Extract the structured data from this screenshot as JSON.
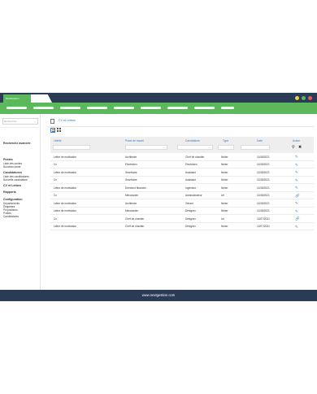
{
  "app": {
    "tab_label": "NextGestion"
  },
  "window_controls": [
    "#e8d34a",
    "#5cb85c",
    "#e05c5c"
  ],
  "sidebar": {
    "search_placeholder": "Rechercher",
    "sections": [
      {
        "label": "Recherche avancée",
        "bold": true
      },
      {
        "label": "Postes",
        "bold": true
      },
      {
        "label": "Liste des postes",
        "bold": false
      },
      {
        "label": "Nouveau poste",
        "bold": false
      },
      {
        "label": "Candidatures",
        "bold": true
      },
      {
        "label": "Liste des candidatures",
        "bold": false
      },
      {
        "label": "Nouvelle candidature",
        "bold": false
      },
      {
        "label": "CV et Lettres",
        "bold": true
      },
      {
        "label": "Rapports",
        "bold": true
      },
      {
        "label": "Configuration",
        "bold": true
      },
      {
        "label": "Départements",
        "bold": false
      },
      {
        "label": "Étiquettes",
        "bold": false
      },
      {
        "label": "Propositions",
        "bold": false
      },
      {
        "label": "Postes",
        "bold": false
      },
      {
        "label": "Candidatures",
        "bold": false
      }
    ]
  },
  "breadcrumb": {
    "label": "CV et Lettres"
  },
  "table": {
    "headers": {
      "libelle": "Libellé",
      "poste": "Poste de travail",
      "candidature": "Candidature",
      "type": "Type",
      "date": "Date",
      "action": "Action"
    },
    "rows": [
      {
        "libelle": "Lettre de motivation",
        "poste": "Architecte",
        "candidature": "Chef de chantier",
        "type": "fichier",
        "date": "11/08/2021",
        "action": "edit"
      },
      {
        "libelle": "Cv",
        "poste": "Electricien",
        "candidature": "Electricien",
        "type": "fichier",
        "date": "11/08/2021",
        "action": "edit"
      },
      {
        "libelle": "Lettre de motivation",
        "poste": "Secrétaire",
        "candidature": "Assistant",
        "type": "fichier",
        "date": "11/08/2021",
        "action": "edit"
      },
      {
        "libelle": "Cv",
        "poste": "Secrétaire",
        "candidature": "Assistant",
        "type": "fichier",
        "date": "11/08/2021",
        "action": "edit"
      },
      {
        "libelle": "Lettre de motivation",
        "poste": "Directeur financier",
        "candidature": "Ingénieur",
        "type": "fichier",
        "date": "11/08/2021",
        "action": "edit"
      },
      {
        "libelle": "Cv",
        "poste": "Mécanicien",
        "candidature": "Administrateur",
        "type": "Url",
        "date": "11/08/2021",
        "action": "link"
      },
      {
        "libelle": "Lettre de motivation",
        "poste": "Architecte",
        "candidature": "Gérant",
        "type": "fichier",
        "date": "11/08/2021",
        "action": "edit"
      },
      {
        "libelle": "Lettre de motivation",
        "poste": "Mécanicien",
        "candidature": "Designer",
        "type": "fichier",
        "date": "11/08/2021",
        "action": "edit"
      },
      {
        "libelle": "Cv",
        "poste": "Chef de chantier",
        "candidature": "Designer",
        "type": "Url",
        "date": "12/07/2021",
        "action": "link"
      },
      {
        "libelle": "Lettre de motivation",
        "poste": "Chef de chantier",
        "candidature": "Designer",
        "type": "fichier",
        "date": "12/07/2021",
        "action": "edit"
      }
    ]
  },
  "footer": {
    "text": "www.nextgestion.com"
  },
  "colors": {
    "accent_green": "#5cb85c",
    "navy": "#2b3a55",
    "link_blue": "#3a7bbf"
  }
}
